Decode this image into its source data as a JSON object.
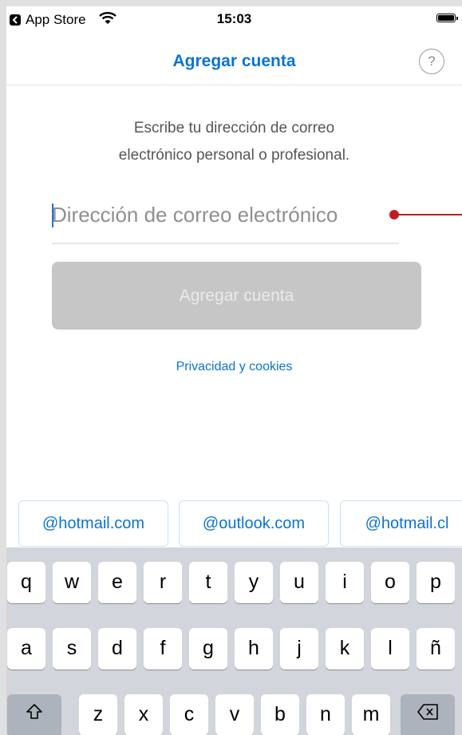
{
  "status_bar": {
    "back_app": "App Store",
    "time": "15:03",
    "icons": [
      "back-arrow-icon",
      "wifi-icon",
      "battery-icon"
    ]
  },
  "navbar": {
    "title": "Agregar cuenta",
    "help_label": "?"
  },
  "content": {
    "instruction_line1": "Escribe tu dirección de correo",
    "instruction_line2": "electrónico personal o profesional.",
    "email_placeholder": "Dirección de correo electrónico",
    "email_value": "",
    "submit_label": "Agregar cuenta",
    "privacy_label": "Privacidad y cookies"
  },
  "suggestions": [
    "@hotmail.com",
    "@outlook.com",
    "@hotmail.cl"
  ],
  "keyboard": {
    "row1": [
      "q",
      "w",
      "e",
      "r",
      "t",
      "y",
      "u",
      "i",
      "o",
      "p"
    ],
    "row2": [
      "a",
      "s",
      "d",
      "f",
      "g",
      "h",
      "j",
      "k",
      "l",
      "ñ"
    ],
    "row3": [
      "z",
      "x",
      "c",
      "v",
      "b",
      "n",
      "m"
    ]
  },
  "colors": {
    "accent": "#0a74d0",
    "disabled_button": "#c6c6c6",
    "annotation": "#c11b22",
    "keyboard_bg": "#d2d5db"
  }
}
